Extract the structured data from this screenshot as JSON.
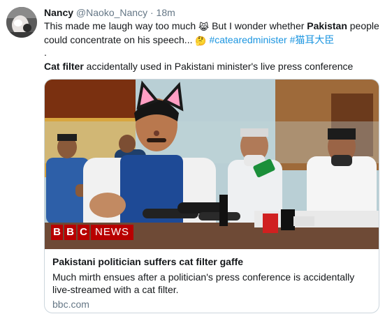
{
  "tweet": {
    "author": {
      "name": "Nancy",
      "handle": "@Naoko_Nancy",
      "separator": "·",
      "time": "18m"
    },
    "text": {
      "part1": "This made me laugh way too much ",
      "emoji1": "😹",
      "part2": " But I wonder whether ",
      "highlight": "Pakistan",
      "part3": " people could concentrate on his speech... ",
      "emoji2": "🤔",
      "hashtag1": "#catearedminister",
      "hashtag2": "#猫耳大臣",
      "dot": ".",
      "line2_bold": "Cat filter",
      "line2_rest": " accidentally used in Pakistani minister's live press conference"
    }
  },
  "card": {
    "logo": {
      "b1": "B",
      "b2": "B",
      "b3": "C",
      "news": "NEWS"
    },
    "title": "Pakistani politician suffers cat filter gaffe",
    "description": "Much mirth ensues after a politician's press conference is accidentally live-streamed with a cat filter.",
    "domain": "bbc.com"
  },
  "colors": {
    "link": "#1b95e0",
    "muted": "#657786",
    "bbc_red": "#b80000",
    "border": "#ccd6dd"
  },
  "icons": [
    "avatar",
    "cat-ears-filter-icon"
  ]
}
